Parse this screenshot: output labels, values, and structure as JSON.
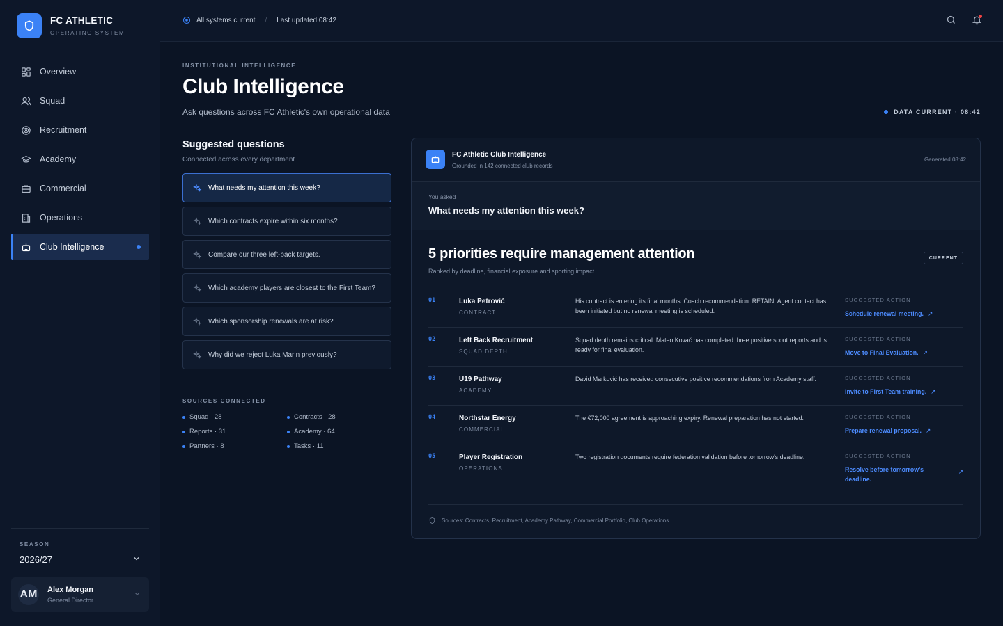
{
  "brand": {
    "name": "FC ATHLETIC",
    "subtitle": "OPERATING SYSTEM",
    "logo_icon": "shield-icon",
    "accent": "#3b82f6"
  },
  "nav": [
    {
      "label": "Overview",
      "icon": "grid-icon",
      "active": false
    },
    {
      "label": "Squad",
      "icon": "users-icon",
      "active": false
    },
    {
      "label": "Recruitment",
      "icon": "target-icon",
      "active": false
    },
    {
      "label": "Academy",
      "icon": "graduation-cap-icon",
      "active": false
    },
    {
      "label": "Commercial",
      "icon": "briefcase-icon",
      "active": false
    },
    {
      "label": "Operations",
      "icon": "building-icon",
      "active": false
    },
    {
      "label": "Club Intelligence",
      "icon": "bot-icon",
      "active": true
    }
  ],
  "season": {
    "label": "SEASON",
    "value": "2026/27"
  },
  "user": {
    "initials": "AM",
    "name": "Alex Morgan",
    "role": "General Director"
  },
  "topbar": {
    "status": "All systems current",
    "separator": "/",
    "updated": "Last updated 08:42"
  },
  "header": {
    "eyebrow": "INSTITUTIONAL INTELLIGENCE",
    "title": "Club Intelligence",
    "subtitle": "Ask questions across FC Athletic's own operational data",
    "data_current": "DATA CURRENT · 08:42"
  },
  "suggested": {
    "title": "Suggested questions",
    "subtitle": "Connected across every department",
    "questions": [
      "What needs my attention this week?",
      "Which contracts expire within six months?",
      "Compare our three left-back targets.",
      "Which academy players are closest to the First Team?",
      "Which sponsorship renewals are at risk?",
      "Why did we reject Luka Marin previously?"
    ],
    "active_index": 0
  },
  "sources": {
    "title": "SOURCES CONNECTED",
    "items": [
      "Squad · 28",
      "Contracts · 28",
      "Reports · 31",
      "Academy · 64",
      "Partners · 8",
      "Tasks · 11"
    ]
  },
  "panel": {
    "title": "FC Athletic Club Intelligence",
    "subtitle": "Grounded in 142 connected club records",
    "generated": "Generated 08:42",
    "asked_label": "You asked",
    "asked_question": "What needs my attention this week?",
    "result_title": "5 priorities require management attention",
    "result_subtitle": "Ranked by deadline, financial exposure and sporting impact",
    "badge": "CURRENT",
    "suggested_action_label": "SUGGESTED ACTION",
    "priorities": [
      {
        "num": "01",
        "name": "Luka Petrović",
        "category": "CONTRACT",
        "description": "His contract is entering its final months. Coach recommendation: RETAIN. Agent contact has been initiated but no renewal meeting is scheduled.",
        "action": "Schedule renewal meeting."
      },
      {
        "num": "02",
        "name": "Left Back Recruitment",
        "category": "SQUAD DEPTH",
        "description": "Squad depth remains critical. Mateo Kovač has completed three positive scout reports and is ready for final evaluation.",
        "action": "Move to Final Evaluation."
      },
      {
        "num": "03",
        "name": "U19 Pathway",
        "category": "ACADEMY",
        "description": "David Marković has received consecutive positive recommendations from Academy staff.",
        "action": "Invite to First Team training."
      },
      {
        "num": "04",
        "name": "Northstar Energy",
        "category": "COMMERCIAL",
        "description": "The €72,000 agreement is approaching expiry. Renewal preparation has not started.",
        "action": "Prepare renewal proposal."
      },
      {
        "num": "05",
        "name": "Player Registration",
        "category": "OPERATIONS",
        "description": "Two registration documents require federation validation before tomorrow's deadline.",
        "action": "Resolve before tomorrow's deadline."
      }
    ],
    "footer": "Sources: Contracts, Recruitment, Academy Pathway, Commercial Portfolio, Club Operations"
  }
}
